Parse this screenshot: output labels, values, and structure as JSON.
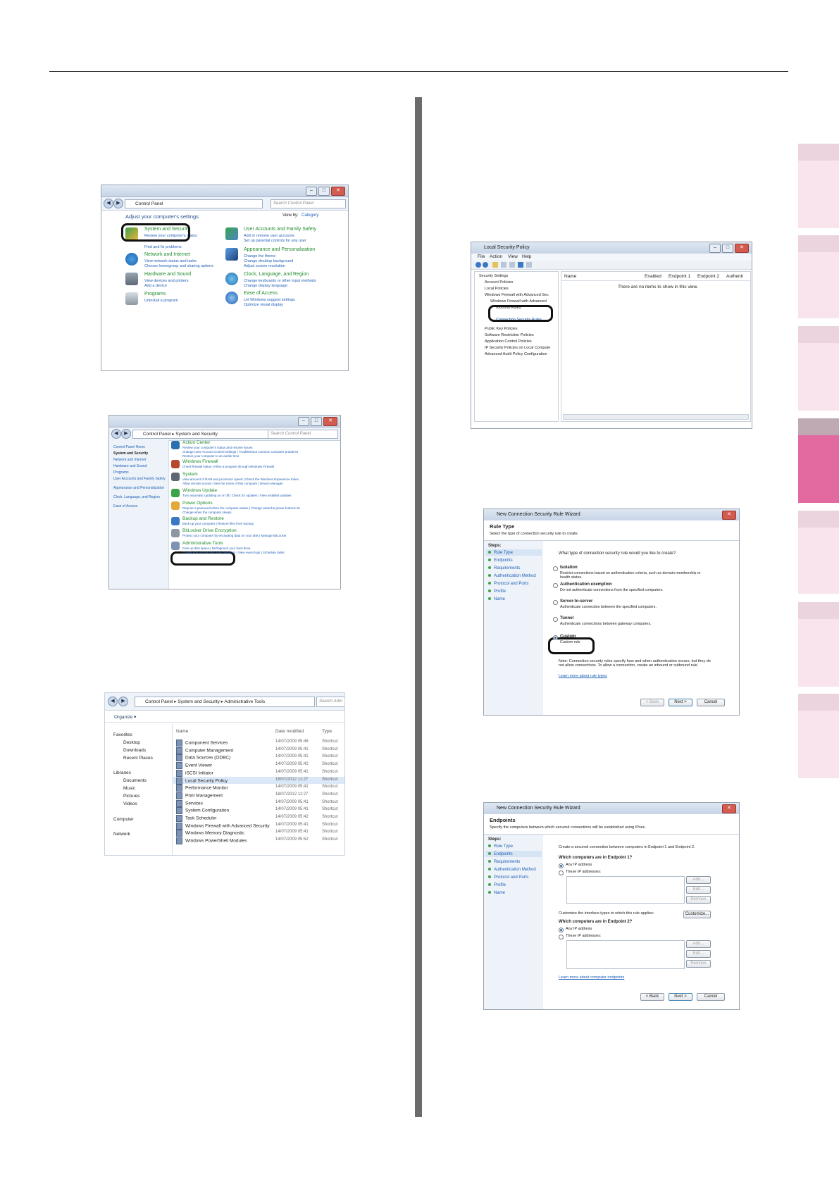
{
  "cp": {
    "crumb": "Control Panel",
    "search": "Search Control Panel",
    "heading": "Adjust your computer's settings",
    "view_by": "View by:",
    "view_val": "Category",
    "sys_title": "System and Security",
    "sys_sub1": "Review your computer's status",
    "sys_sub2": "Find and fix problems",
    "net_title": "Network and Internet",
    "net_sub1": "View network status and tasks",
    "net_sub2": "Choose homegroup and sharing options",
    "hw_title": "Hardware and Sound",
    "hw_sub1": "View devices and printers",
    "hw_sub2": "Add a device",
    "prog_title": "Programs",
    "prog_sub1": "Uninstall a program",
    "user_title": "User Accounts and Family Safety",
    "user_sub1": "Add or remove user accounts",
    "user_sub2": "Set up parental controls for any user",
    "app_title": "Appearance and Personalization",
    "app_sub1": "Change the theme",
    "app_sub2": "Change desktop background",
    "app_sub3": "Adjust screen resolution",
    "clock_title": "Clock, Language, and Region",
    "clock_sub1": "Change keyboards or other input methods",
    "clock_sub2": "Change display language",
    "ease_title": "Ease of Access",
    "ease_sub1": "Let Windows suggest settings",
    "ease_sub2": "Optimize visual display"
  },
  "ss": {
    "crumb": "Control Panel  ▸  System and Security",
    "search": "Search Control Panel",
    "side": [
      "Control Panel Home",
      "System and Security",
      "Network and Internet",
      "Hardware and Sound",
      "Programs",
      "User Accounts and Family Safety",
      "Appearance and Personalization",
      "Clock, Language, and Region",
      "Ease of Access"
    ],
    "items": [
      {
        "title": "Action Center",
        "subs": [
          "Review your computer's status and resolve issues",
          "Change User Account Control settings  |  Troubleshoot common computer problems",
          "Restore your computer to an earlier time"
        ]
      },
      {
        "title": "Windows Firewall",
        "subs": [
          "Check firewall status  |  Allow a program through Windows Firewall"
        ]
      },
      {
        "title": "System",
        "subs": [
          "View amount of RAM and processor speed  |  Check the Windows Experience Index",
          "Allow remote access  |  See the name of this computer  |  Device Manager"
        ]
      },
      {
        "title": "Windows Update",
        "subs": [
          "Turn automatic updating on or off  |  Check for updates  |  View installed updates"
        ]
      },
      {
        "title": "Power Options",
        "subs": [
          "Require a password when the computer wakes  |  Change what the power buttons do",
          "Change when the computer sleeps"
        ]
      },
      {
        "title": "Backup and Restore",
        "subs": [
          "Back up your computer  |  Restore files from backup"
        ]
      },
      {
        "title": "BitLocker Drive Encryption",
        "subs": [
          "Protect your computer by encrypting data on your disk  |  Manage BitLocker"
        ]
      },
      {
        "title": "Administrative Tools",
        "subs": [
          "Free up disk space  |  Defragment your hard drive",
          "Create and format hard disk partitions  |  View event logs  |  Schedule tasks"
        ]
      }
    ]
  },
  "at": {
    "crumb": "Control Panel  ▸  System and Security  ▸  Administrative Tools",
    "search": "Search Adm",
    "organize": "Organize ▾",
    "nav": [
      "Favorites",
      "Desktop",
      "Downloads",
      "Recent Places",
      "Libraries",
      "Documents",
      "Music",
      "Pictures",
      "Videos",
      "Computer",
      "Network"
    ],
    "headers": [
      "Name",
      "Date modified",
      "Type"
    ],
    "rows": [
      [
        "Component Services",
        "14/07/2009 05:46",
        "Shortcut"
      ],
      [
        "Computer Management",
        "14/07/2009 05:41",
        "Shortcut"
      ],
      [
        "Data Sources (ODBC)",
        "14/07/2009 05:41",
        "Shortcut"
      ],
      [
        "Event Viewer",
        "14/07/2009 05:42",
        "Shortcut"
      ],
      [
        "iSCSI Initiator",
        "14/07/2009 05:41",
        "Shortcut"
      ],
      [
        "Local Security Policy",
        "18/07/2012 11:27",
        "Shortcut"
      ],
      [
        "Performance Monitor",
        "14/07/2009 05:41",
        "Shortcut"
      ],
      [
        "Print Management",
        "18/07/2012 11:27",
        "Shortcut"
      ],
      [
        "Services",
        "14/07/2009 05:41",
        "Shortcut"
      ],
      [
        "System Configuration",
        "14/07/2009 05:41",
        "Shortcut"
      ],
      [
        "Task Scheduler",
        "14/07/2009 05:42",
        "Shortcut"
      ],
      [
        "Windows Firewall with Advanced Security",
        "14/07/2009 05:41",
        "Shortcut"
      ],
      [
        "Windows Memory Diagnostic",
        "14/07/2009 05:41",
        "Shortcut"
      ],
      [
        "Windows PowerShell Modules",
        "14/07/2009 05:52",
        "Shortcut"
      ]
    ]
  },
  "lsp": {
    "title": "Local Security Policy",
    "menu": [
      "File",
      "Action",
      "View",
      "Help"
    ],
    "tree": [
      "Security Settings",
      "Account Policies",
      "Local Policies",
      "Windows Firewall with Advanced Sec",
      "Windows Firewall with Advanced",
      "Inbound Rules",
      "Connection Security Rules",
      "Public Key Policies",
      "Software Restriction Policies",
      "Application Control Policies",
      "IP Security Policies on Local Compute",
      "Advanced Audit Policy Configuration"
    ],
    "cols": [
      "Name",
      "Enabled",
      "Endpoint 1",
      "Endpoint 2",
      "Authenti"
    ],
    "empty": "There are no items to show in this view."
  },
  "wiz1": {
    "title": "New Connection Security Rule Wizard",
    "heading": "Rule Type",
    "desc": "Select the type of connection security rule to create.",
    "steps_label": "Steps:",
    "steps": [
      "Rule Type",
      "Endpoints",
      "Requirements",
      "Authentication Method",
      "Protocol and Ports",
      "Profile",
      "Name"
    ],
    "question": "What type of connection security rule would you like to create?",
    "options": [
      {
        "name": "Isolation",
        "desc": "Restrict connections based on authentication criteria, such as domain membership or health status."
      },
      {
        "name": "Authentication exemption",
        "desc": "Do not authenticate connections from the specified computers."
      },
      {
        "name": "Server-to-server",
        "desc": "Authenticate connection between the specified computers."
      },
      {
        "name": "Tunnel",
        "desc": "Authenticate connections between gateway computers."
      },
      {
        "name": "Custom",
        "desc": "Custom rule"
      }
    ],
    "note": "Note:  Connection security rules specify how and when authentication occurs, but they do not allow connections.  To allow a connection, create an inbound or outbound rule.",
    "learn": "Learn more about rule types",
    "back": "< Back",
    "next": "Next >",
    "cancel": "Cancel"
  },
  "wiz2": {
    "title": "New Connection Security Rule Wizard",
    "heading": "Endpoints",
    "desc": "Specify the computers between which secured connections will be established using IPsec.",
    "steps_label": "Steps:",
    "steps": [
      "Rule Type",
      "Endpoints",
      "Requirements",
      "Authentication Method",
      "Protocol and Ports",
      "Profile",
      "Name"
    ],
    "intro": "Create a secured connection between computers in Endpoint 1 and Endpoint 2.",
    "q1": "Which computers are in Endpoint 1?",
    "any": "Any IP address",
    "these": "These IP addresses:",
    "add": "Add...",
    "edit": "Edit...",
    "remove": "Remove",
    "customize_label": "Customize the interface types to which this rule applies:",
    "customize": "Customize...",
    "q2": "Which computers are in Endpoint 2?",
    "learn": "Learn more about computer endpoints",
    "back": "< Back",
    "next": "Next >",
    "cancel": "Cancel"
  }
}
